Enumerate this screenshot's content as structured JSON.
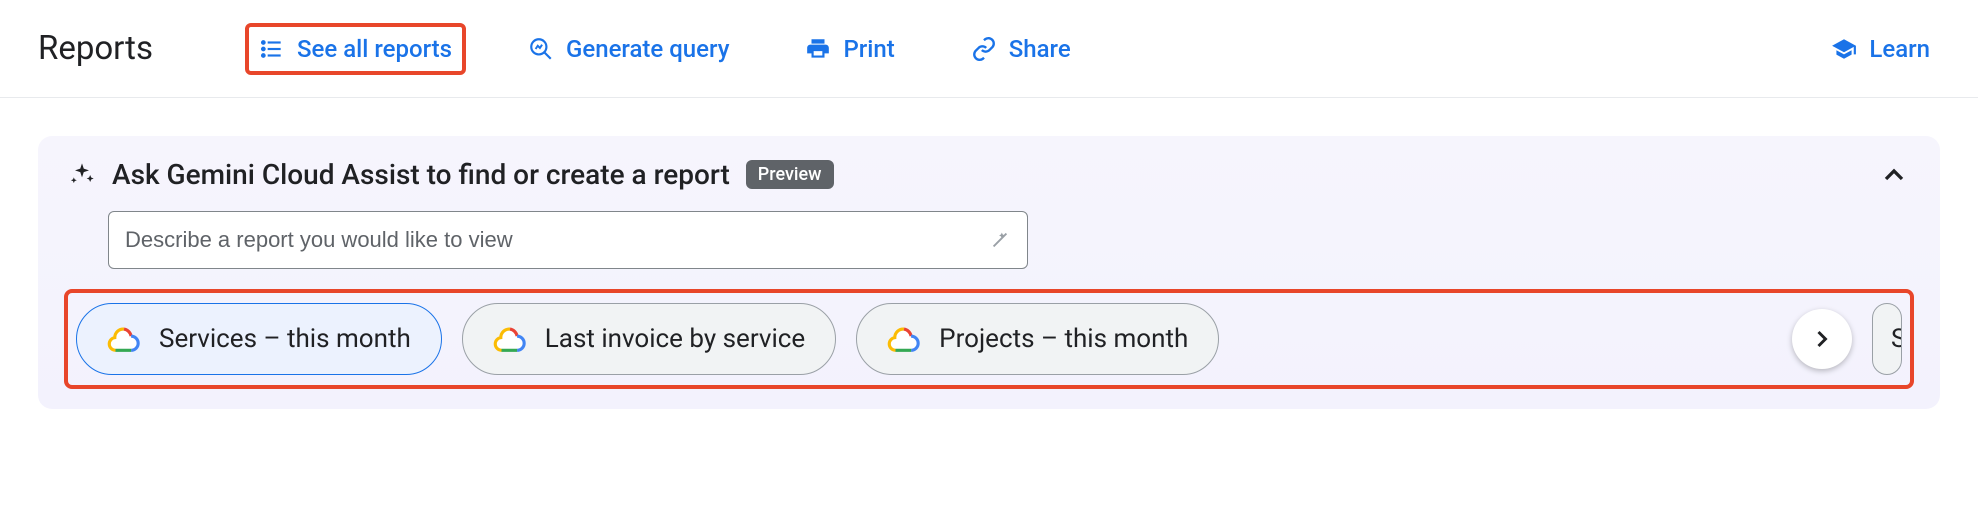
{
  "header": {
    "title": "Reports",
    "see_all": "See all reports",
    "generate_query": "Generate query",
    "print": "Print",
    "share": "Share",
    "learn": "Learn"
  },
  "gemini": {
    "title": "Ask Gemini Cloud Assist to find or create a report",
    "badge": "Preview",
    "placeholder": "Describe a report you would like to view",
    "chips": [
      "Services – this month",
      "Last invoice by service",
      "Projects – this month"
    ],
    "peek_chip": "S"
  }
}
